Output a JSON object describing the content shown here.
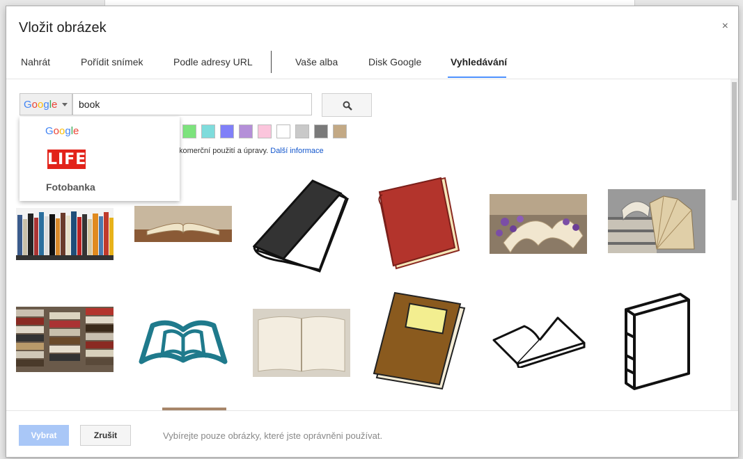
{
  "dialog": {
    "title": "Vložit obrázek",
    "close_symbol": "×"
  },
  "tabs": [
    {
      "label": "Nahrát"
    },
    {
      "label": "Pořídit snímek"
    },
    {
      "label": "Podle adresy URL"
    },
    {
      "label": "Vaše alba"
    },
    {
      "label": "Disk Google"
    },
    {
      "label": "Vyhledávání",
      "active": true
    }
  ],
  "search": {
    "engine_selected": "Google",
    "query": "book",
    "search_icon": "search-icon"
  },
  "engine_dropdown": {
    "options": [
      {
        "label": "Google"
      },
      {
        "label": "LIFE"
      },
      {
        "label": "Fotobanka"
      }
    ]
  },
  "color_filters": [
    "#7de37d",
    "#7fdcdc",
    "#8080f8",
    "#b48fd8",
    "#fbc5dc",
    "#ffffff",
    "#c9c9c9",
    "#7a7a7a",
    "#c3a985"
  ],
  "license_note": {
    "text": "komerční použití a úpravy.",
    "link": "Další informace"
  },
  "results": [
    {
      "subject": "bookshelf row photo"
    },
    {
      "subject": "open book on table"
    },
    {
      "subject": "black book clipart"
    },
    {
      "subject": "red book clipart"
    },
    {
      "subject": "open book with lavender"
    },
    {
      "subject": "open book pages fanned"
    },
    {
      "subject": "stacks of books"
    },
    {
      "subject": "teal open book icon"
    },
    {
      "subject": "blank open book"
    },
    {
      "subject": "brown book clipart"
    },
    {
      "subject": "open book outline"
    },
    {
      "subject": "closed book outline"
    }
  ],
  "footer": {
    "select_label": "Vybrat",
    "cancel_label": "Zrušit",
    "note": "Vybírejte pouze obrázky, které jste oprávněni používat."
  }
}
